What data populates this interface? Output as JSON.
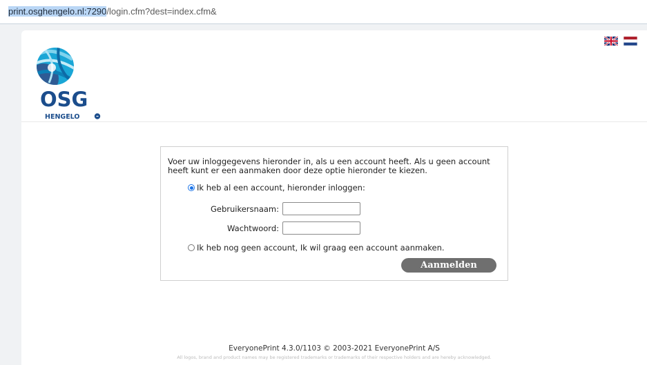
{
  "address_bar": {
    "url_selected": "print.osghengelo.nl:7290",
    "url_rest": "/login.cfm?dest=index.cfm&"
  },
  "logo": {
    "brand": "OSG",
    "location": "HENGELO"
  },
  "languages": [
    "english-flag",
    "dutch-flag"
  ],
  "login": {
    "intro": "Voer uw inloggegevens hieronder in, als u een account heeft. Als u geen account heeft kunt er een aanmaken door deze optie hieronder te kiezen.",
    "option_existing": "Ik heb al een account, hieronder inloggen:",
    "username_label": "Gebruikersnaam:",
    "username_value": "",
    "password_label": "Wachtwoord:",
    "password_value": "",
    "option_new": "Ik heb nog geen account, Ik wil graag een account aanmaken.",
    "submit_label": "Aanmelden",
    "selected_option": "existing"
  },
  "footer": {
    "version": "EveryonePrint 4.3.0/1103 © 2003-2021 EveryonePrint A/S",
    "legal": "All logos, brand and product names may be registered trademarks or trademarks of their respective holders and are hereby acknowledged."
  },
  "colors": {
    "accent": "#1a73e8",
    "logo_blue": "#1b4d8c",
    "button": "#6f6f6f"
  }
}
